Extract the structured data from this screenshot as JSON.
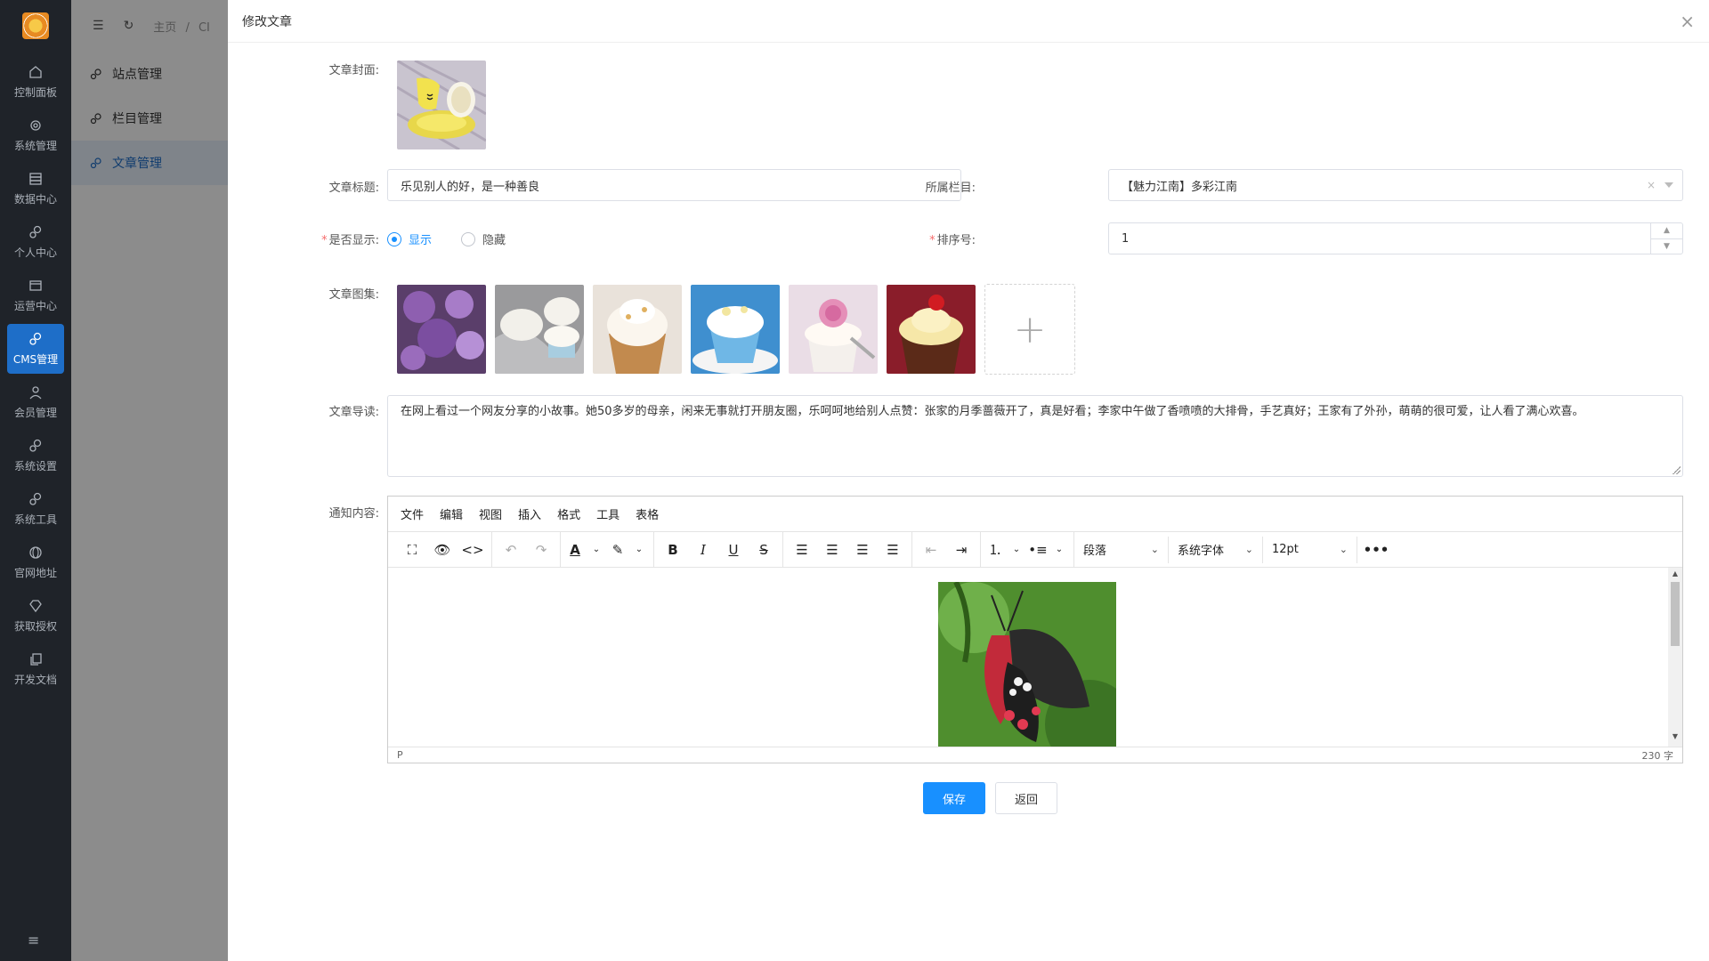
{
  "rail": {
    "items": [
      {
        "label": "控制面板",
        "icon": "home-icon"
      },
      {
        "label": "系统管理",
        "icon": "gear-icon"
      },
      {
        "label": "数据中心",
        "icon": "database-icon"
      },
      {
        "label": "个人中心",
        "icon": "gears-icon"
      },
      {
        "label": "运营中心",
        "icon": "card-icon"
      },
      {
        "label": "CMS管理",
        "icon": "gears-icon",
        "active": true
      },
      {
        "label": "会员管理",
        "icon": "user-icon"
      },
      {
        "label": "系统设置",
        "icon": "gears-icon"
      },
      {
        "label": "系统工具",
        "icon": "gears-icon"
      },
      {
        "label": "官网地址",
        "icon": "globe-icon"
      },
      {
        "label": "获取授权",
        "icon": "diamond-icon"
      },
      {
        "label": "开发文档",
        "icon": "copy-icon"
      }
    ]
  },
  "header": {
    "breadcrumb_home": "主页",
    "breadcrumb_sep": "/",
    "breadcrumb_current": "CI"
  },
  "sidebar": {
    "items": [
      {
        "label": "站点管理"
      },
      {
        "label": "栏目管理"
      },
      {
        "label": "文章管理",
        "active": true
      }
    ]
  },
  "modal": {
    "title": "修改文章",
    "close": "×",
    "labels": {
      "cover": "文章封面:",
      "title": "文章标题:",
      "category": "所属栏目:",
      "visible": "是否显示:",
      "sort": "排序号:",
      "gallery": "文章图集:",
      "intro": "文章导读:",
      "content": "通知内容:"
    },
    "fields": {
      "title_value": "乐见别人的好，是一种善良",
      "category_value": "【魅力江南】多彩江南",
      "category_clear": "×",
      "sort_value": "1",
      "radio_show": "显示",
      "radio_hide": "隐藏",
      "visible_selected": "显示",
      "intro_value": "在网上看过一个网友分享的小故事。她50多岁的母亲，闲来无事就打开朋友圈，乐呵呵地给别人点赞：张家的月季蔷薇开了，真是好看；李家中午做了香喷喷的大排骨，手艺真好；王家有了外孙，萌萌的很可爱，让人看了满心欢喜。",
      "gallery_add": "+"
    },
    "editor": {
      "menus": [
        "文件",
        "编辑",
        "视图",
        "插入",
        "格式",
        "工具",
        "表格"
      ],
      "block_format": "段落",
      "font_family": "系统字体",
      "font_size": "12pt",
      "status_path": "P",
      "word_count": "230 字"
    },
    "buttons": {
      "save": "保存",
      "back": "返回"
    }
  },
  "colors": {
    "primary": "#1890ff",
    "rail_bg": "#1f2329",
    "rail_active": "#1e6ec8"
  }
}
